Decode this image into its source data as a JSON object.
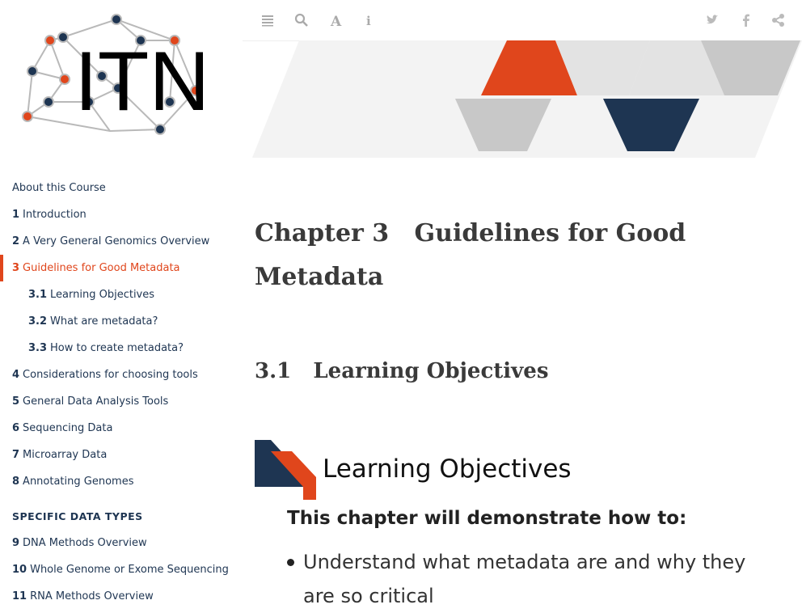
{
  "sidebar": {
    "logo_text": "ITN",
    "items": [
      {
        "num": "",
        "label": "About this Course",
        "level": 1
      },
      {
        "num": "1",
        "label": "Introduction",
        "level": 1
      },
      {
        "num": "2",
        "label": "A Very General Genomics Overview",
        "level": 1
      },
      {
        "num": "3",
        "label": "Guidelines for Good Metadata",
        "level": 1,
        "active": true
      },
      {
        "num": "3.1",
        "label": "Learning Objectives",
        "level": 2
      },
      {
        "num": "3.2",
        "label": "What are metadata?",
        "level": 2
      },
      {
        "num": "3.3",
        "label": "How to create metadata?",
        "level": 2
      },
      {
        "num": "4",
        "label": "Considerations for choosing tools",
        "level": 1
      },
      {
        "num": "5",
        "label": "General Data Analysis Tools",
        "level": 1
      },
      {
        "num": "6",
        "label": "Sequencing Data",
        "level": 1
      },
      {
        "num": "7",
        "label": "Microarray Data",
        "level": 1
      },
      {
        "num": "8",
        "label": "Annotating Genomes",
        "level": 1
      }
    ],
    "section_header": "SPECIFIC DATA TYPES",
    "items2": [
      {
        "num": "9",
        "label": "DNA Methods Overview"
      },
      {
        "num": "10",
        "label": "Whole Genome or Exome Sequencing"
      },
      {
        "num": "11",
        "label": "RNA Methods Overview"
      }
    ]
  },
  "toolbar": {
    "left_icons": [
      "menu-icon",
      "search-icon",
      "font-icon",
      "info-icon"
    ],
    "right_icons": [
      "twitter-icon",
      "facebook-icon",
      "share-icon"
    ]
  },
  "main": {
    "chapter_prefix": "Chapter 3",
    "chapter_title_line1": "Guidelines for Good",
    "chapter_title_line2": "Metadata",
    "section_num": "3.1",
    "section_title": "Learning Objectives",
    "lo_heading": "Learning Objectives",
    "lo_sub": "This chapter will demonstrate how to:",
    "lo_items": [
      "Understand what metadata are and why they are so critical"
    ]
  },
  "colors": {
    "accent": "#e0461c",
    "navy": "#1e3552",
    "grey": "#c8c8c8"
  }
}
